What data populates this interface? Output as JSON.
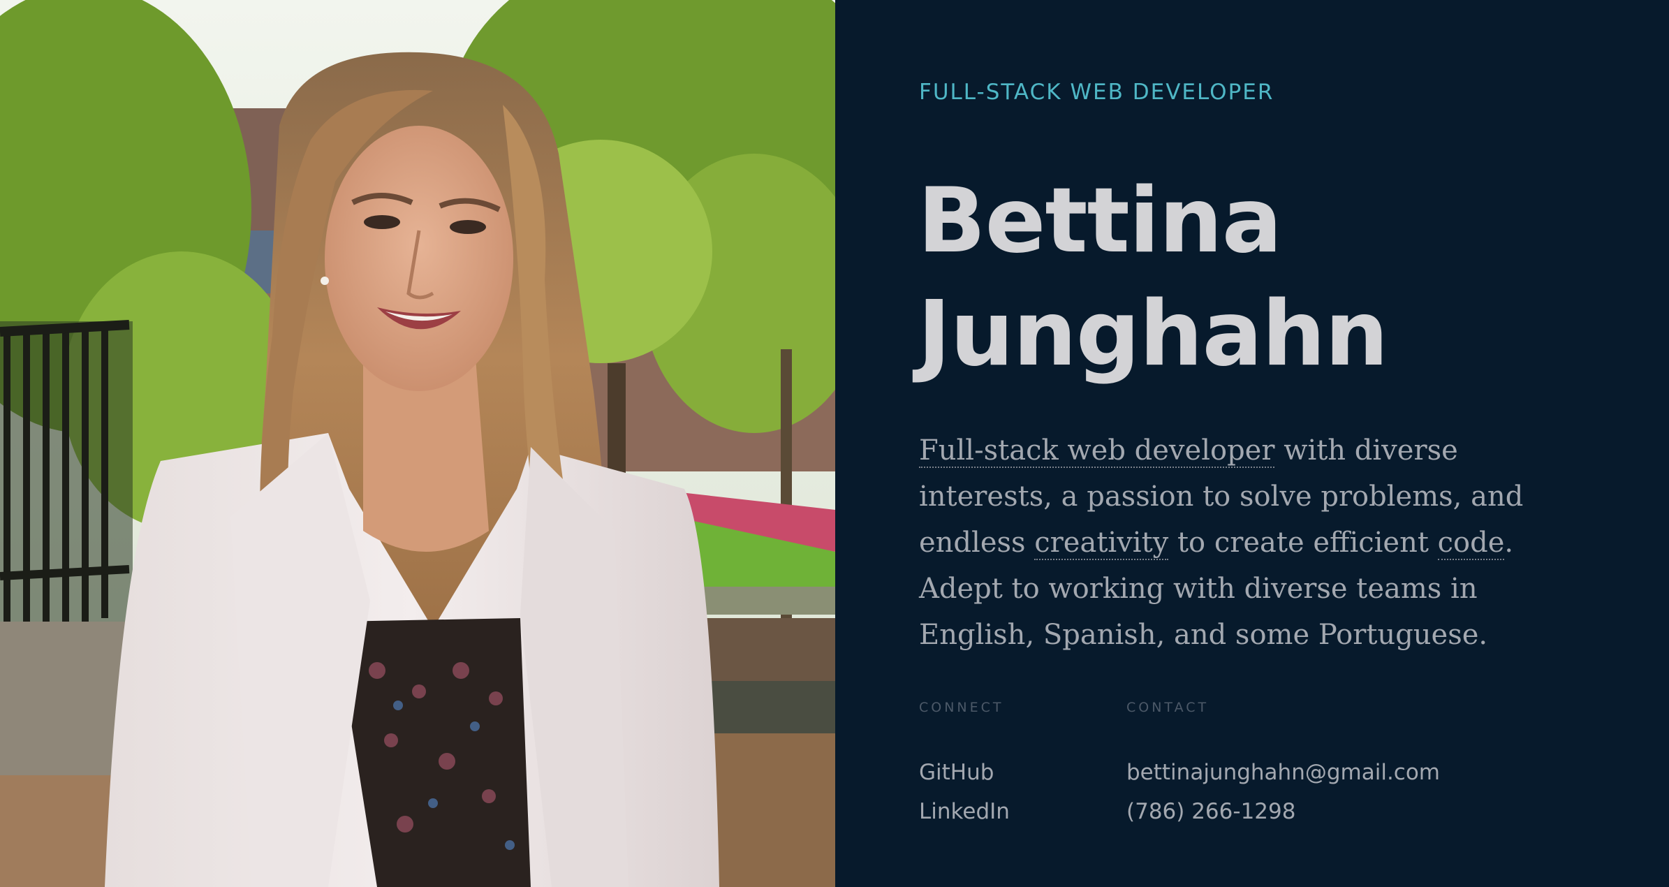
{
  "hero": {
    "eyebrow": "FULL-STACK WEB DEVELOPER",
    "name_first": "Bettina",
    "name_last": "Junghahn"
  },
  "bio": {
    "link_role": "Full-stack web developer",
    "text_1": " with diverse interests, a passion to solve problems, and endless ",
    "link_creativity": "creativity",
    "text_2": " to create efficient ",
    "link_code": "code",
    "text_3": ". Adept to working with diverse teams in English, Spanish, and some Portuguese."
  },
  "connect": {
    "label": "CONNECT",
    "github": "GitHub",
    "linkedin": "LinkedIn"
  },
  "contact": {
    "label": "CONTACT",
    "email": "bettinajunghahn@gmail.com",
    "phone": "(786) 266-1298"
  },
  "colors": {
    "background": "#071a2c",
    "accent": "#4fb7c6",
    "heading": "#d3d3d6",
    "body_text": "#a3a8b0"
  }
}
